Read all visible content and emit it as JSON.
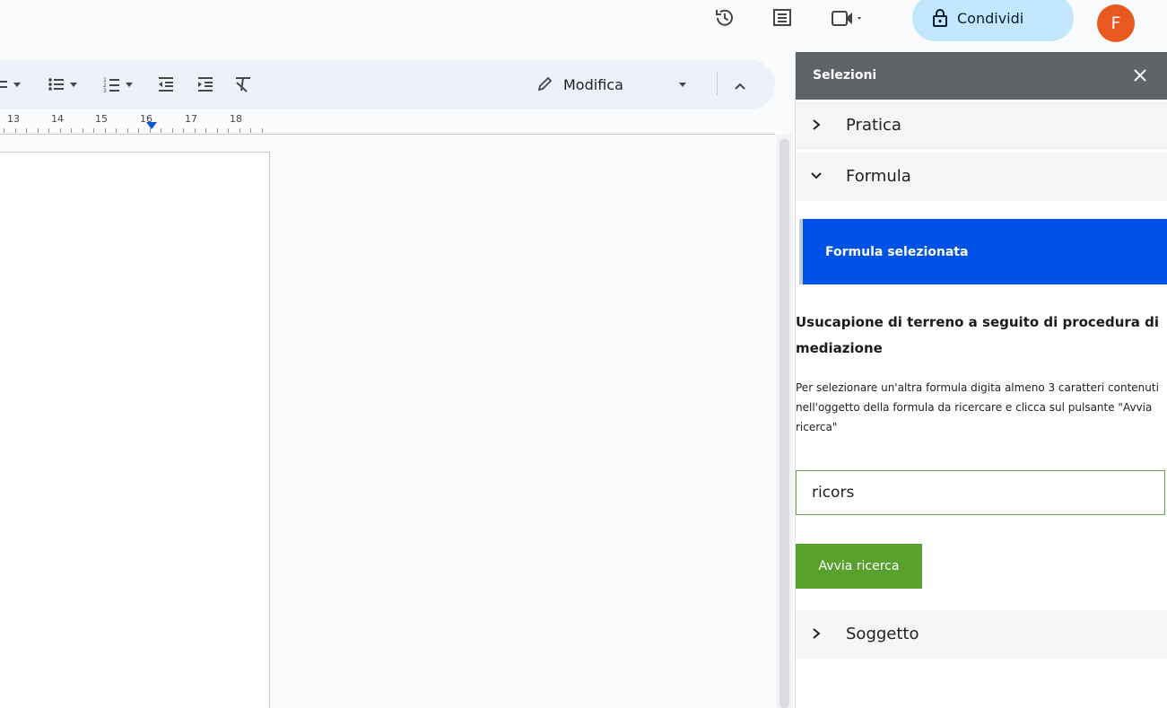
{
  "topbar": {
    "share_label": "Condividi",
    "avatar_letter": "F"
  },
  "toolbar": {
    "edit_mode_label": "Modifica"
  },
  "ruler": {
    "numbers": [
      "13",
      "14",
      "15",
      "16",
      "17",
      "18"
    ]
  },
  "panel": {
    "title": "Selezioni",
    "sections": {
      "pratica": "Pratica",
      "formula": "Formula",
      "soggetto": "Soggetto"
    },
    "selected_box_label": "Formula selezionata",
    "formula_name": "Usucapione di terreno a seguito di procedura di mediazione",
    "instructions": "Per selezionare un'altra formula digita almeno 3 caratteri contenuti nell'oggetto della formula da ricercare e clicca sul pulsante \"Avvia ricerca\"",
    "search_value": "ricors",
    "search_button": "Avvia ricerca"
  },
  "colors": {
    "accent_blue": "#0052e6",
    "button_green": "#5aa02c",
    "share_bg": "#c2e7ff",
    "avatar_bg": "#e8591f",
    "panel_header": "#5f6368"
  }
}
